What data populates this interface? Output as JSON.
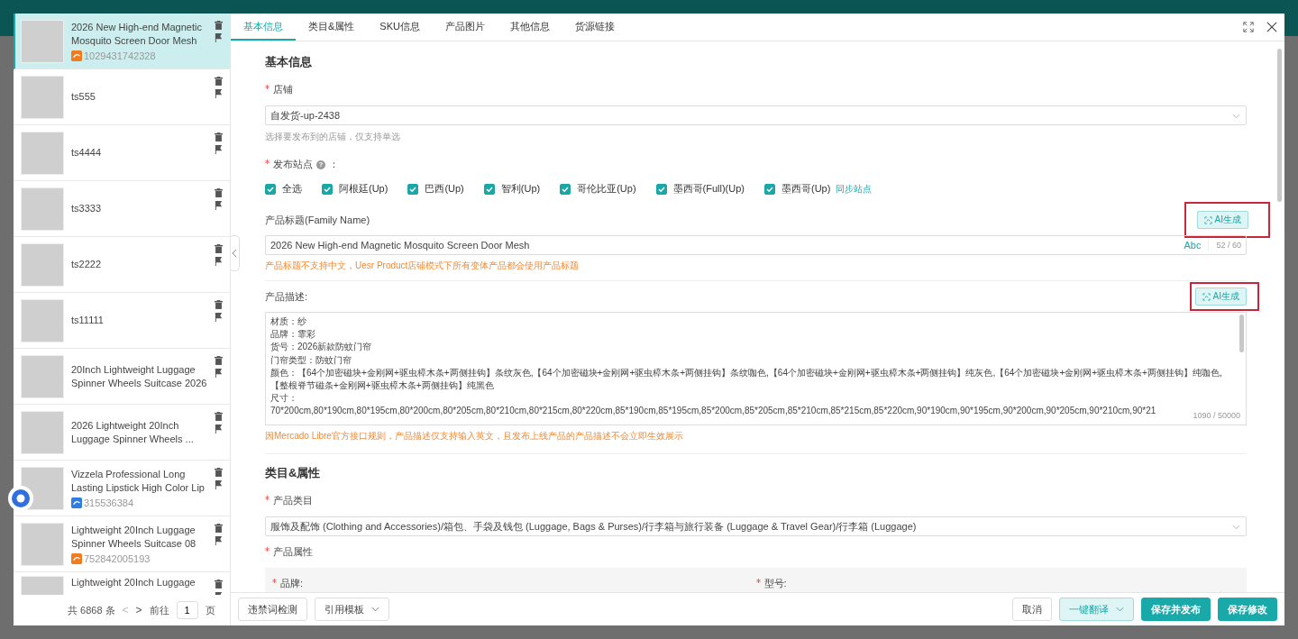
{
  "products": [
    {
      "title": "2026 New High-end Magnetic Mosquito Screen Door Mesh",
      "id": "1029431742328",
      "color": "#f07c1f",
      "selected": true
    },
    {
      "title": "ts555",
      "selected": false
    },
    {
      "title": "ts4444",
      "selected": false
    },
    {
      "title": "ts3333",
      "selected": false
    },
    {
      "title": "ts2222",
      "selected": false
    },
    {
      "title": "ts11111",
      "selected": false
    },
    {
      "title": "20Inch Lightweight Luggage Spinner Wheels Suitcase 2026",
      "selected": false
    },
    {
      "title": "2026 Lightweight 20Inch Luggage Spinner Wheels ...",
      "selected": false
    },
    {
      "title": "Vizzela Professional Long Lasting Lipstick High Color Lip",
      "id": "315536384",
      "color": "#2f7de1",
      "selected": false
    },
    {
      "title": "Lightweight 20Inch Luggage Spinner Wheels Suitcase 08",
      "id": "752842005193",
      "color": "#f07c1f",
      "selected": false
    },
    {
      "title": "Lightweight 20Inch Luggage",
      "selected": false
    }
  ],
  "pagination": {
    "total": "共 6868 条",
    "prev": "<",
    "next": ">",
    "goto": "前往",
    "page": "1",
    "unit": "页"
  },
  "tabs": [
    {
      "label": "基本信息",
      "selected": true
    },
    {
      "label": "类目&属性",
      "selected": false
    },
    {
      "label": "SKU信息",
      "selected": false
    },
    {
      "label": "产品图片",
      "selected": false
    },
    {
      "label": "其他信息",
      "selected": false
    },
    {
      "label": "货源链接",
      "selected": false
    }
  ],
  "basic": {
    "heading": "基本信息",
    "shop_label": "店铺",
    "shop_required": true,
    "shop_value": "自发货-up-2438",
    "shop_hint": "选择要发布到的店铺，仅支持单选",
    "sites_label": "发布站点",
    "sites_required": true,
    "sites_help": "?",
    "sites_colon": "：",
    "sites": [
      {
        "label": "全选",
        "checked": true
      },
      {
        "label": "阿根廷(Up)",
        "checked": true
      },
      {
        "label": "巴西(Up)",
        "checked": true
      },
      {
        "label": "智利(Up)",
        "checked": true
      },
      {
        "label": "哥伦比亚(Up)",
        "checked": true
      },
      {
        "label": "墨西哥(Full)(Up)",
        "checked": true
      },
      {
        "label": "墨西哥(Up)",
        "checked": true
      }
    ],
    "sync_link": "同步站点",
    "title_label": "产品标题(Family Name)",
    "ai_button": "AI生成",
    "title_value": "2026 New High-end Magnetic Mosquito Screen Door Mesh",
    "abc": "Abc",
    "title_count": "52 / 60",
    "title_warning": "产品标题不支持中文，Uesr Product店铺模式下所有变体产品都会使用产品标题",
    "desc_label": "产品描述:",
    "desc_ai_button": "AI生成",
    "desc_lines": [
      "材质：纱",
      "品牌：霏彩",
      "货号：2026新款防蚊门帘",
      "门帘类型：防蚊门帘",
      "颜色：【64个加密磁块+金刚网+驱虫樟木条+两侧挂钩】条纹灰色,【64个加密磁块+金刚网+驱虫樟木条+两侧挂钩】条纹咖色,【64个加密磁块+金刚网+驱虫樟木条+两侧挂钩】纯灰色,【64个加密磁块+金刚网+驱虫樟木条+两侧挂钩】纯咖色,【整根脊节磁条+金刚网+驱虫樟木条+两侧挂钩】纯黑色",
      "尺寸：",
      "70*200cm,80*190cm,80*195cm,80*200cm,80*205cm,80*210cm,80*215cm,80*220cm,85*190cm,85*195cm,85*200cm,85*205cm,85*210cm,85*215cm,85*220cm,90*190cm,90*195cm,90*200cm,90*205cm,90*210cm,90*21"
    ],
    "desc_count": "1090 / 50000",
    "desc_warning": "因Mercado Libre官方接口规则，产品描述仅支持输入英文，且发布上线产品的产品描述不会立即生效展示"
  },
  "category": {
    "heading": "类目&属性",
    "category_label": "产品类目",
    "category_required": true,
    "category_value": "服饰及配饰 (Clothing and Accessories)/箱包、手袋及钱包 (Luggage, Bags & Purses)/行李箱与旅行装备 (Luggage & Travel Gear)/行李箱 (Luggage)",
    "attr_label": "产品属性",
    "attr_required": true,
    "attrs": [
      {
        "label": "品牌:",
        "required": true
      },
      {
        "label": "型号:",
        "required": true
      }
    ]
  },
  "footer": {
    "left": [
      "违禁词检测",
      "引用模板"
    ],
    "cancel": "取消",
    "translate": "一键翻译",
    "publish": "保存并发布",
    "save": "保存修改"
  }
}
